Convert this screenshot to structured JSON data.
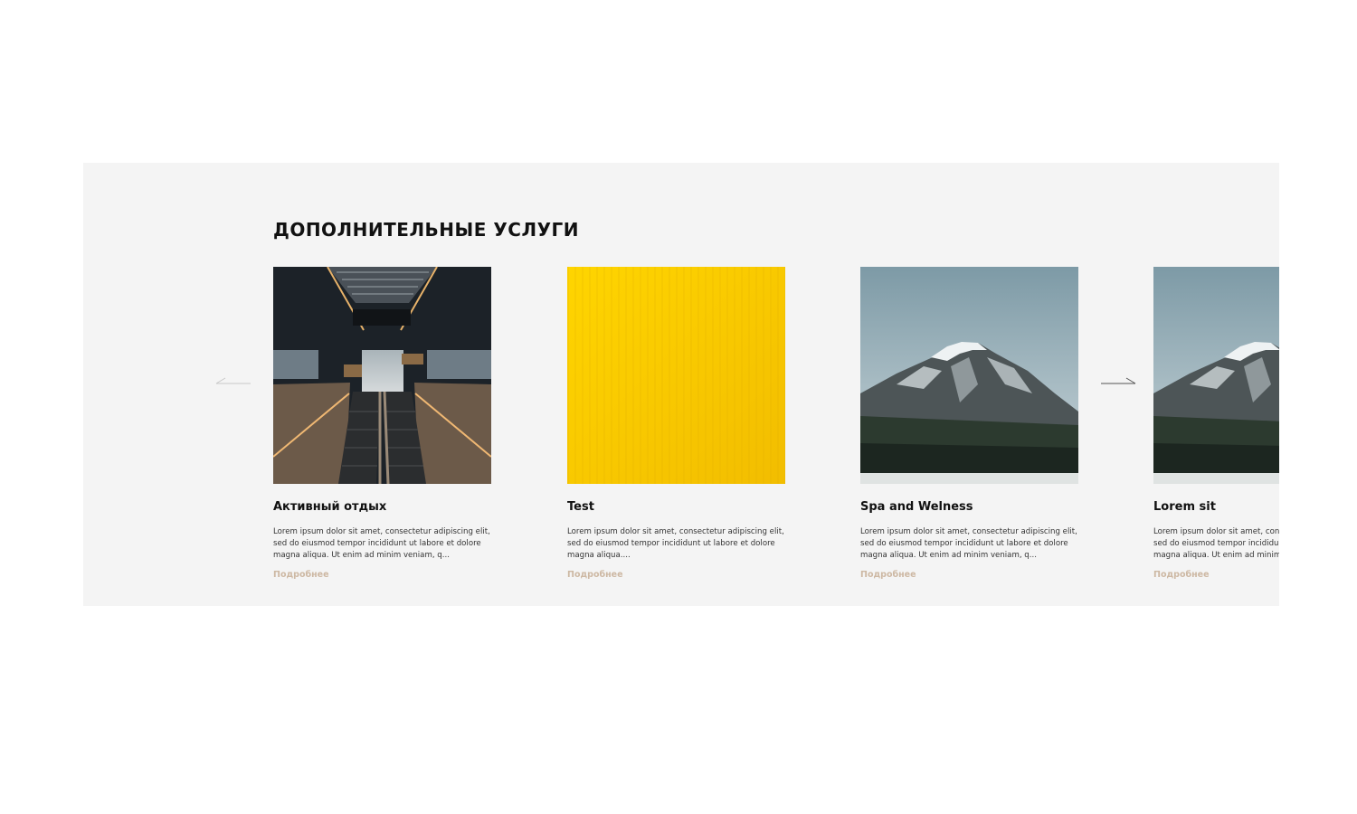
{
  "section": {
    "title": "ДОПОЛНИТЕЛЬНЫЕ УСЛУГИ",
    "background": "#f4f4f4"
  },
  "slider": {
    "prev_icon": "arrow-left-icon",
    "next_icon": "arrow-right-icon"
  },
  "cards": [
    {
      "title": "Активный отдых",
      "text": "Lorem ipsum dolor sit amet, consectetur adipiscing elit, sed do eiusmod tempor incididunt ut labore et dolore magna aliqua. Ut enim ad minim veniam, q...",
      "link": "Подробнее",
      "image": "escalator-station-photo"
    },
    {
      "title": "Test",
      "text": "Lorem ipsum dolor sit amet, consectetur adipiscing elit, sed do eiusmod tempor incididunt ut labore et dolore magna aliqua....",
      "link": "Подробнее",
      "image": "yellow-texture-photo"
    },
    {
      "title": "Spa and Welness",
      "text": "Lorem ipsum dolor sit amet, consectetur adipiscing elit, sed do eiusmod tempor incididunt ut labore et dolore magna aliqua. Ut enim ad minim veniam, q...",
      "link": "Подробнее",
      "image": "mountain-photo"
    },
    {
      "title": "Lorem sit",
      "text": "Lorem ipsum dolor sit amet, consectetur adipiscing elit, sed do eiusmod tempor incididunt ut labore et dolore magna aliqua. Ut enim ad minim veniam, q...",
      "link": "Подробнее",
      "image": "mountain-photo"
    }
  ],
  "colors": {
    "link": "#cdb8a3",
    "title": "#111111",
    "yellow": "#ffd000"
  }
}
